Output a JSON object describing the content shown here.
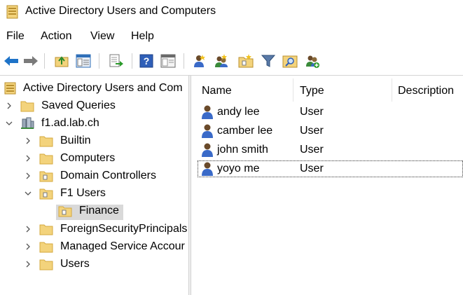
{
  "window": {
    "title": "Active Directory Users and Computers"
  },
  "menu": {
    "file": "File",
    "action": "Action",
    "view": "View",
    "help": "Help"
  },
  "toolbar": {
    "icons": [
      "back-arrow",
      "forward-arrow",
      "up-folder",
      "show-console-tree",
      "export-list",
      "help",
      "properties",
      "new-user",
      "new-group",
      "new-ou",
      "filter",
      "find",
      "add-to-group"
    ]
  },
  "tree": {
    "root": "Active Directory Users and Com",
    "saved_queries": "Saved Queries",
    "domain": "f1.ad.lab.ch",
    "builtin": "Builtin",
    "computers": "Computers",
    "domain_controllers": "Domain Controllers",
    "f1_users": "F1 Users",
    "finance": "Finance",
    "foreign": "ForeignSecurityPrincipals",
    "msa": "Managed Service Accour",
    "users": "Users"
  },
  "list": {
    "columns": {
      "name": "Name",
      "type": "Type",
      "description": "Description"
    },
    "rows": [
      {
        "name": "andy lee",
        "type": "User"
      },
      {
        "name": "camber lee",
        "type": "User"
      },
      {
        "name": "john smith",
        "type": "User"
      },
      {
        "name": "yoyo me",
        "type": "User"
      }
    ]
  },
  "colors": {
    "folder": "#f3d37c",
    "folder_edge": "#d4a83e",
    "selected_bg": "#d9d9d9",
    "accent_blue": "#1e73c8"
  }
}
